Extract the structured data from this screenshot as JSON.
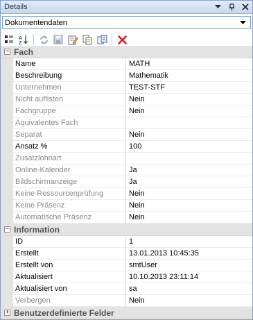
{
  "panel": {
    "title": "Details"
  },
  "dropdown": {
    "value": "Dokumentendaten"
  },
  "toolbar": {
    "buttons": [
      "categorized-icon",
      "sort-az-icon",
      "refresh-icon",
      "save-icon",
      "edit-icon",
      "copy-icon",
      "pages-icon",
      "delete-icon"
    ]
  },
  "sections": {
    "fach": {
      "label": "Fach",
      "expander": "−",
      "rows": [
        {
          "name": "Name",
          "value": "MATH"
        },
        {
          "name": "Beschreibung",
          "value": "Mathematik"
        },
        {
          "name": "Unternehmen",
          "value": "TEST-STF"
        },
        {
          "name": "Nicht auflisten",
          "value": "Nein"
        },
        {
          "name": "Fachgruppe",
          "value": "Nein"
        },
        {
          "name": "Äquivalentes Fach",
          "value": ""
        },
        {
          "name": "Separat",
          "value": "Nein"
        },
        {
          "name": "Ansatz %",
          "value": "100"
        },
        {
          "name": "Zusatzlohnart",
          "value": ""
        },
        {
          "name": "Online-Kalender",
          "value": "Ja"
        },
        {
          "name": "Bildschirmanzeige",
          "value": "Ja"
        },
        {
          "name": "Keine Ressourcenprüfung",
          "value": "Nein"
        },
        {
          "name": "Keine Präsenz",
          "value": "Nein"
        },
        {
          "name": "Automatische Präsenz",
          "value": "Nein"
        }
      ]
    },
    "information": {
      "label": "Information",
      "expander": "−",
      "rows": [
        {
          "name": "ID",
          "value": "1"
        },
        {
          "name": "Erstellt",
          "value": "13.01.2013 10:45:35"
        },
        {
          "name": "Erstellt von",
          "value": "smtUser"
        },
        {
          "name": "Aktualisiert",
          "value": "10.10.2013 23:11:14"
        },
        {
          "name": "Aktualisiert von",
          "value": "sa"
        },
        {
          "name": "Verbergen",
          "value": "Nein"
        }
      ]
    },
    "benutzer": {
      "label": "Benutzerdefinierte Felder",
      "expander": "+"
    }
  },
  "colors": {
    "disabled_text": "#8a8a8a",
    "delete": "#d81f1f"
  }
}
